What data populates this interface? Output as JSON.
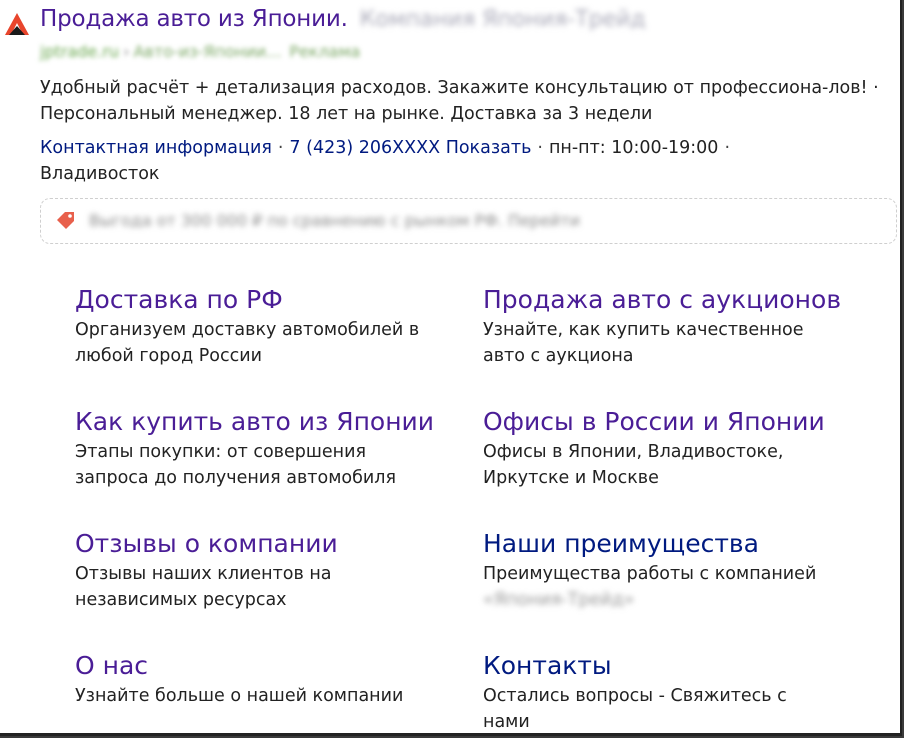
{
  "header": {
    "title": "Продажа авто из Японии.",
    "title_suffix_blurred": "Компания Япония-Трейд",
    "url_domain_blurred": "jptrade.ru",
    "url_path_blurred": "Авто-из-Японии...",
    "ad_label_blurred": "Реклама",
    "colors": {
      "title": "#4a1d96",
      "link": "#001a80",
      "logo": "#e8452c"
    }
  },
  "description": "Удобный расчёт + детализация расходов. Закажите консультацию от профессиона-лов! · Персональный менеджер. 18 лет на рынке. Доставка за 3 недели",
  "contacts": {
    "contact_info_label": "Контактная информация",
    "phone": "7 (423) 206XXXX",
    "show_label": "Показать",
    "hours": "пн-пт: 10:00-19:00",
    "city": "Владивосток"
  },
  "promo": {
    "icon": "price-tag-icon",
    "text_blurred": "Выгода от 300 000 ₽ по сравнению с рынком РФ. Перейти"
  },
  "sitelinks": [
    {
      "title": "Доставка по РФ",
      "desc": "Организуем доставку автомобилей в любой город России"
    },
    {
      "title": "Продажа авто с аукционов",
      "desc": "Узнайте, как купить качественное авто с аукциона"
    },
    {
      "title": "Как купить авто из Японии",
      "desc": "Этапы покупки: от совершения запроса до получения автомобиля"
    },
    {
      "title": "Офисы в России и Японии",
      "desc": "Офисы в Японии, Владивостоке, Иркутске и Москве"
    },
    {
      "title": "Отзывы о компании",
      "desc": "Отзывы наших клиентов на независимых ресурсах"
    },
    {
      "title": "Наши преимущества",
      "desc": "Преимущества работы с компанией",
      "desc_blurred": "«Япония-Трейд»"
    },
    {
      "title": "О нас",
      "desc": "Узнайте больше о нашей компании"
    },
    {
      "title": "Контакты",
      "desc": "Остались вопросы - Свяжитесь с нами"
    }
  ]
}
